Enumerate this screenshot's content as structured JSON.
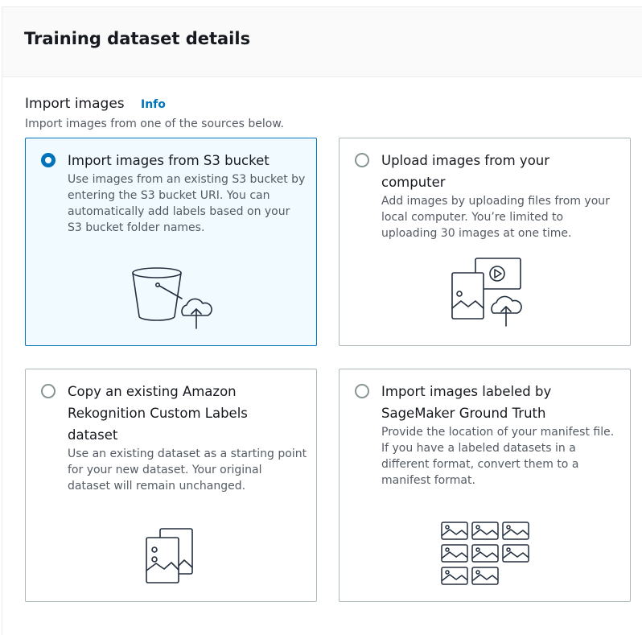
{
  "panel": {
    "title": "Training dataset details"
  },
  "import_images": {
    "label": "Import images",
    "info_link": "Info",
    "description": "Import images from one of the sources below."
  },
  "options": [
    {
      "title": "Import images from S3 bucket",
      "description": "Use images from an existing S3 bucket by entering the S3 bucket URI. You can automatically add labels based on your S3 bucket folder names.",
      "selected": true,
      "icon": "s3-bucket-upload-icon"
    },
    {
      "title": "Upload images from your computer",
      "description": "Add images by uploading files from your local computer. You’re limited to uploading 30 images at one time.",
      "selected": false,
      "icon": "images-upload-icon"
    },
    {
      "title": "Copy an existing Amazon Rekognition Custom Labels dataset",
      "description": "Use an existing dataset as a starting point for your new dataset. Your original dataset will remain unchanged.",
      "selected": false,
      "icon": "dataset-copy-icon"
    },
    {
      "title": "Import images labeled by SageMaker Ground Truth",
      "description": "Provide the location of your manifest file. If you have a labeled datasets in a different format, convert them to a manifest format.",
      "selected": false,
      "icon": "image-grid-icon"
    }
  ],
  "colors": {
    "accent": "#0073bb",
    "selected_tile_bg": "#f1faff",
    "border": "#aab7b8",
    "text": "#16191f",
    "secondary_text": "#545b64"
  }
}
